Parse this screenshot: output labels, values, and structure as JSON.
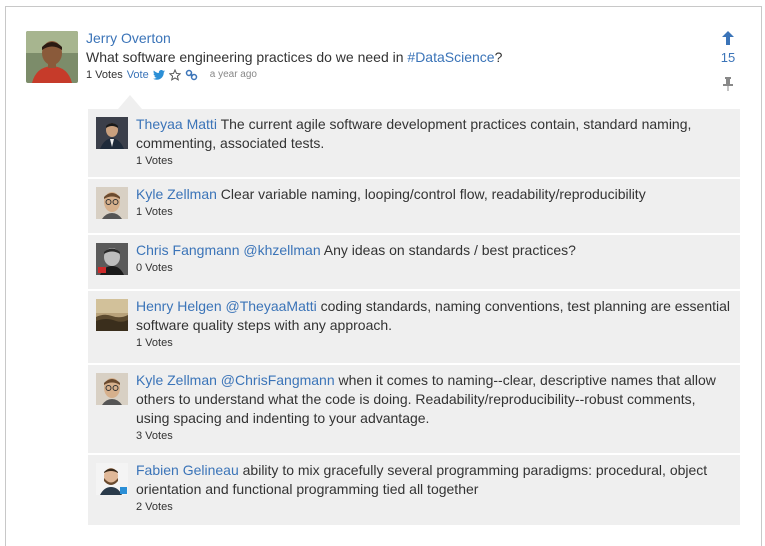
{
  "post": {
    "author": "Jerry Overton",
    "text_prefix": "What software engineering practices do we need in ",
    "hashtag": "#DataScience",
    "text_suffix": "?",
    "votes_label": "1 Votes",
    "vote_link": "Vote",
    "time": "a year ago",
    "upvote_count": "15"
  },
  "comments": [
    {
      "author": "Theyaa Matti",
      "mention": "",
      "text": " The current agile software development practices contain, standard naming, commenting, associated tests.",
      "votes": "1 Votes"
    },
    {
      "author": "Kyle Zellman",
      "mention": "",
      "text": " Clear variable naming, looping/control flow, readability/reproducibility",
      "votes": "1 Votes"
    },
    {
      "author": "Chris Fangmann",
      "mention": " @khzellman",
      "text": " Any ideas on standards / best practices?",
      "votes": "0 Votes"
    },
    {
      "author": "Henry Helgen",
      "mention": " @TheyaaMatti",
      "text": " coding standards, naming conventions, test planning are essential software quality steps with any approach.",
      "votes": "1 Votes"
    },
    {
      "author": "Kyle Zellman",
      "mention": " @ChrisFangmann",
      "text": " when it comes to naming--clear, descriptive names that allow others to understand what the code is doing. Readability/reproducibility--robust comments, using spacing and indenting to your advantage.",
      "votes": "3 Votes"
    },
    {
      "author": "Fabien Gelineau",
      "mention": "",
      "text": " ability to mix gracefully several programming paradigms: procedural, object orientation and functional programming tied all together",
      "votes": "2 Votes"
    }
  ],
  "colors": {
    "link": "#3b74b8",
    "comment_bg": "#efefef",
    "twitter": "#2b8fd6"
  },
  "icons": {
    "upvote": "arrow-up-icon",
    "twitter": "twitter-bird-icon",
    "star": "star-outline-icon",
    "link": "chain-link-icon",
    "pin": "pushpin-icon"
  }
}
